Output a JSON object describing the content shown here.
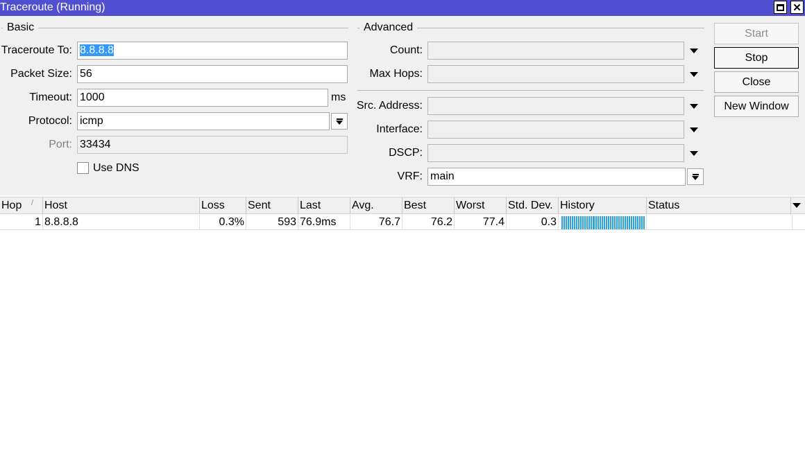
{
  "window": {
    "title": "Traceroute (Running)"
  },
  "basic": {
    "section_title": "Basic",
    "traceroute_to": {
      "label": "Traceroute To:",
      "value": "8.8.8.8"
    },
    "packet_size": {
      "label": "Packet Size:",
      "value": "56"
    },
    "timeout": {
      "label": "Timeout:",
      "value": "1000",
      "unit": "ms"
    },
    "protocol": {
      "label": "Protocol:",
      "value": "icmp"
    },
    "port": {
      "label": "Port:",
      "value": "33434"
    },
    "use_dns": {
      "label": "Use DNS",
      "checked": false
    }
  },
  "advanced": {
    "section_title": "Advanced",
    "count": {
      "label": "Count:",
      "value": ""
    },
    "max_hops": {
      "label": "Max Hops:",
      "value": ""
    },
    "src_address": {
      "label": "Src. Address:",
      "value": ""
    },
    "interface": {
      "label": "Interface:",
      "value": ""
    },
    "dscp": {
      "label": "DSCP:",
      "value": ""
    },
    "vrf": {
      "label": "VRF:",
      "value": "main"
    }
  },
  "buttons": {
    "start": "Start",
    "stop": "Stop",
    "close": "Close",
    "new_window": "New Window"
  },
  "table": {
    "columns": [
      "Hop",
      "Host",
      "Loss",
      "Sent",
      "Last",
      "Avg.",
      "Best",
      "Worst",
      "Std. Dev.",
      "History",
      "Status"
    ],
    "sort_indicator": "/",
    "rows": [
      {
        "hop": "1",
        "host": "8.8.8.8",
        "loss": "0.3%",
        "sent": "593",
        "last": "76.9ms",
        "avg": "76.7",
        "best": "76.2",
        "worst": "77.4",
        "std_dev": "0.3",
        "status": ""
      }
    ]
  },
  "colors": {
    "titlebar": "#4f4fd0",
    "history_bar": "#29a3d8",
    "selection": "#3399ff"
  }
}
